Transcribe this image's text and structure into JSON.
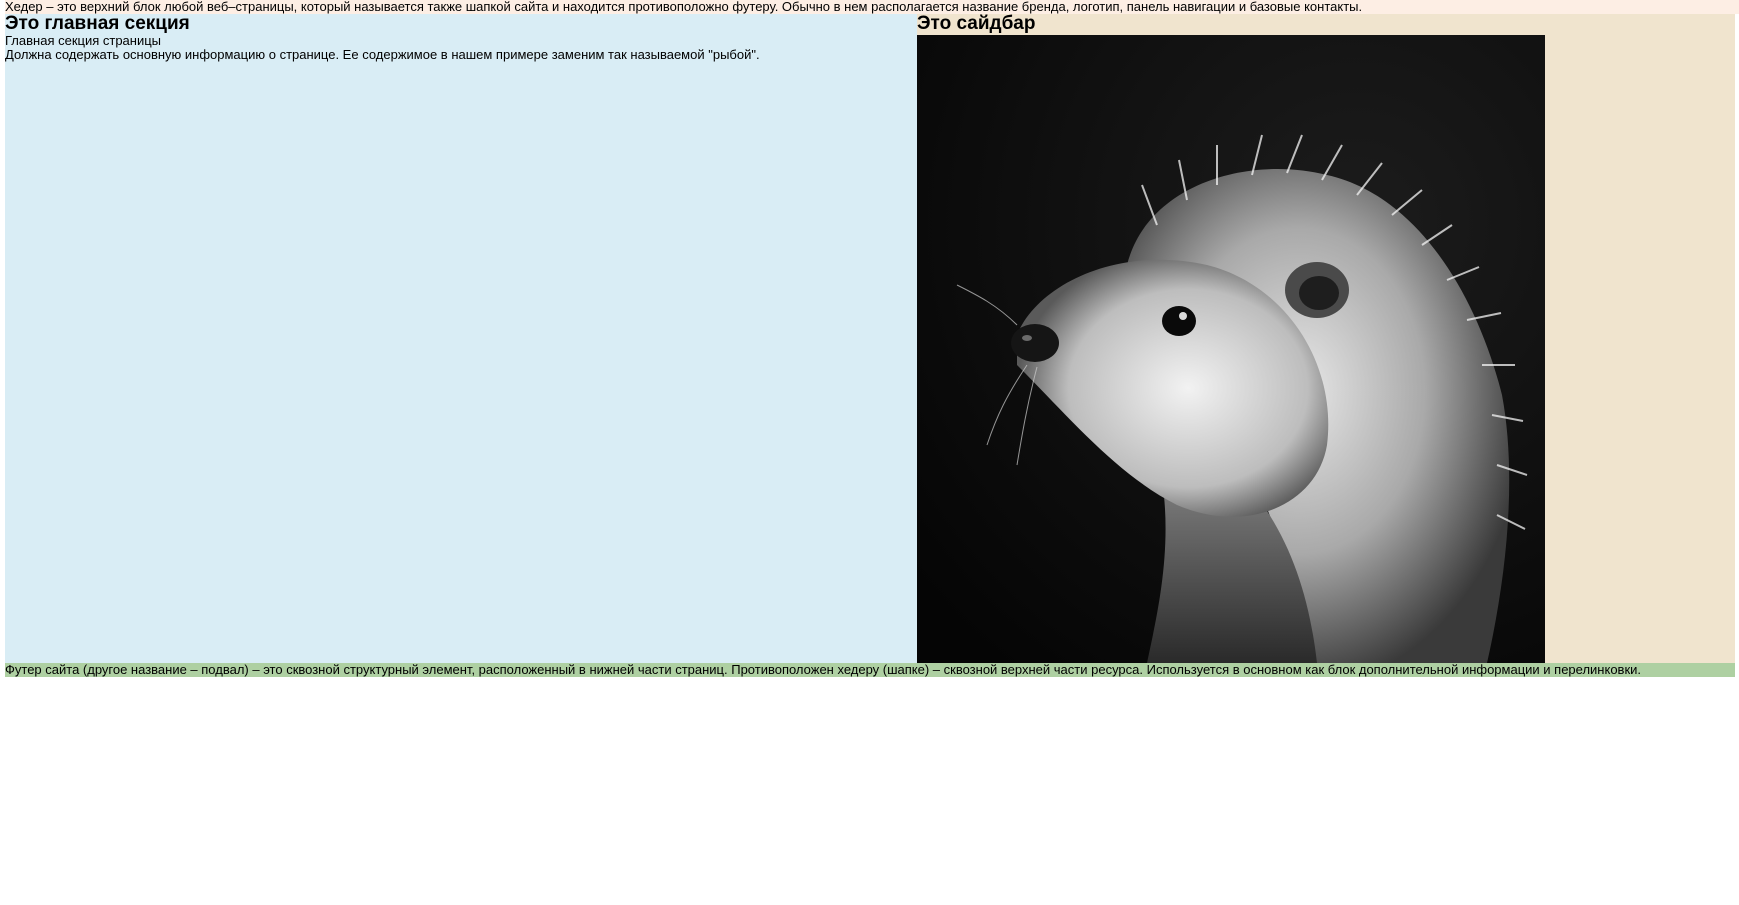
{
  "header": {
    "text": "Хедер – это верхний блок любой веб–страницы, который называется также шапкой сайта и находится противоположно футеру. Обычно в нем располагается название бренда, логотип, панель навигации и базовые контакты."
  },
  "main": {
    "title": "Это главная секция",
    "subtitle": "Главная секция страницы",
    "description": "Должна содержать основную информацию о странице. Ее содержимое в нашем примере заменим так называемой \"рыбой\"."
  },
  "sidebar": {
    "title": "Это сайдбар",
    "image": "hedgehog-photo"
  },
  "footer": {
    "text": "Футер сайта (другое название – подвал) – это сквозной структурный элемент, расположенный в нижней части страниц. Противоположен хедеру (шапке) – сквозной верхней части ресурса. Используется в основном как блок дополнительной информации и перелинковки."
  },
  "colors": {
    "header_bg": "#fdeee4",
    "main_bg": "#d9edf5",
    "sidebar_bg": "#f0e4ce",
    "footer_bg": "#aed0a2"
  }
}
